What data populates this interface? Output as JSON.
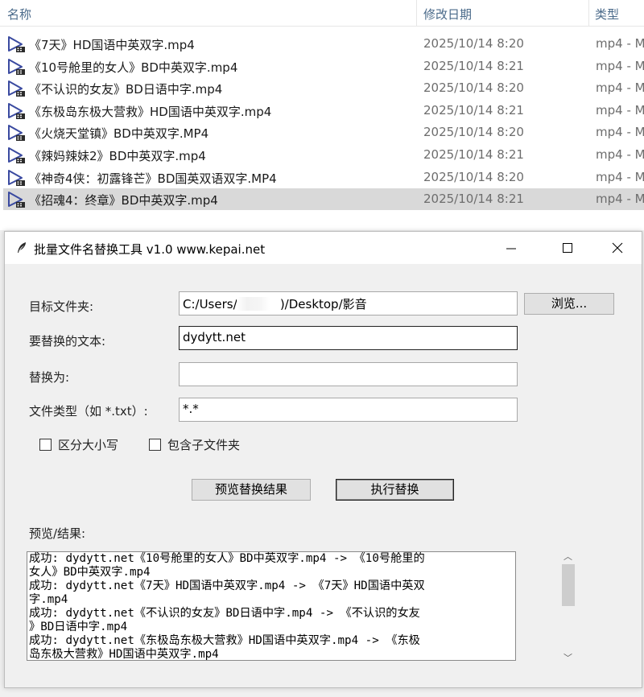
{
  "explorer": {
    "columns": {
      "name": "名称",
      "date": "修改日期",
      "type": "类型"
    },
    "files": [
      {
        "name": "《7天》HD国语中英双字.mp4",
        "date": "2025/10/14 8:20",
        "type": "mp4 - M"
      },
      {
        "name": "《10号舱里的女人》BD中英双字.mp4",
        "date": "2025/10/14 8:21",
        "type": "mp4 - M"
      },
      {
        "name": "《不认识的女友》BD日语中字.mp4",
        "date": "2025/10/14 8:20",
        "type": "mp4 - M"
      },
      {
        "name": "《东极岛东极大营救》HD国语中英双字.mp4",
        "date": "2025/10/14 8:21",
        "type": "mp4 - M"
      },
      {
        "name": "《火烧天堂镇》BD中英双字.MP4",
        "date": "2025/10/14 8:20",
        "type": "mp4 - M"
      },
      {
        "name": "《辣妈辣妹2》BD中英双字.mp4",
        "date": "2025/10/14 8:21",
        "type": "mp4 - M"
      },
      {
        "name": "《神奇4侠：初露锋芒》BD国英双语双字.MP4",
        "date": "2025/10/14 8:20",
        "type": "mp4 - M"
      },
      {
        "name": "《招魂4：终章》BD中英双字.mp4",
        "date": "2025/10/14 8:21",
        "type": "mp4 - M"
      }
    ],
    "selected_index": 7
  },
  "window": {
    "title": "批量文件名替换工具 v1.0 www.kepai.net",
    "form": {
      "folder_label": "目标文件夹:",
      "folder_value": "C:/Users/A         )/Desktop/影音",
      "browse_label": "浏览...",
      "find_label": "要替换的文本:",
      "find_value": "dydytt.net",
      "replace_label": "替换为:",
      "replace_value": "",
      "type_label": "文件类型（如 *.txt）:",
      "type_value": "*.*",
      "case_label": "区分大小写",
      "subfolder_label": "包含子文件夹",
      "preview_button": "预览替换结果",
      "execute_button": "执行替换",
      "result_label": "预览/结果:"
    },
    "result_lines": [
      "成功: dydytt.net《10号舱里的女人》BD中英双字.mp4 -> 《10号舱里的",
      "女人》BD中英双字.mp4",
      "成功: dydytt.net《7天》HD国语中英双字.mp4 -> 《7天》HD国语中英双",
      "字.mp4",
      "成功: dydytt.net《不认识的女友》BD日语中字.mp4 -> 《不认识的女友",
      "》BD日语中字.mp4",
      "成功: dydytt.net《东极岛东极大营救》HD国语中英双字.mp4 -> 《东极",
      "岛东极大营救》HD国语中英双字.mp4"
    ],
    "colors": {
      "accent_icon": "#3a4aa0",
      "selected_row": "#d9d9d9"
    }
  }
}
